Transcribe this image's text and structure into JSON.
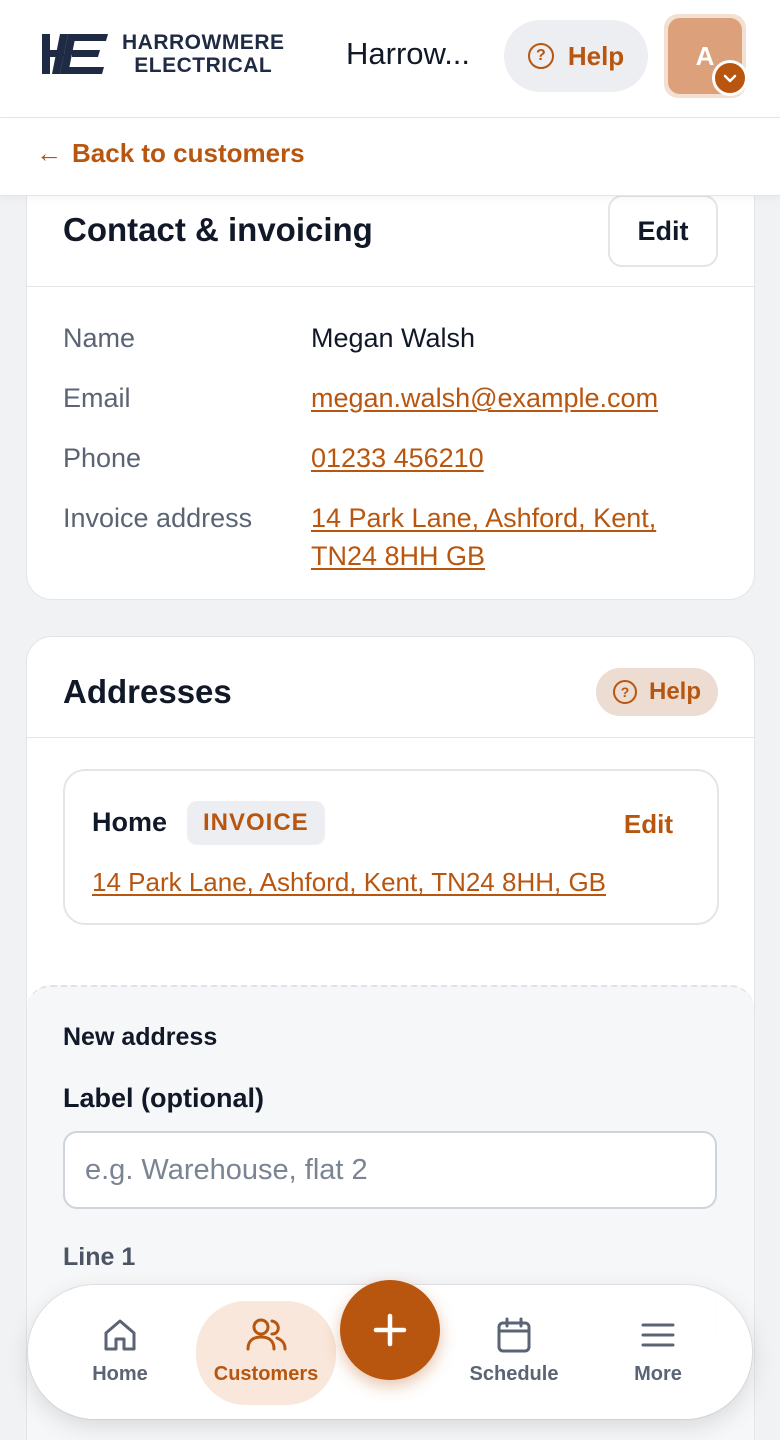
{
  "header": {
    "logo_line1": "HARROWMERE",
    "logo_line2": "ELECTRICAL",
    "app_title": "Harrow...",
    "help_label": "Help",
    "avatar_initial": "A"
  },
  "back": {
    "label": "Back to customers"
  },
  "contact": {
    "title": "Contact & invoicing",
    "edit_label": "Edit",
    "rows": [
      {
        "label": "Name",
        "value": "Megan Walsh"
      },
      {
        "label": "Email",
        "value": "megan.walsh@example.com"
      },
      {
        "label": "Phone",
        "value": "01233 456210"
      },
      {
        "label": "Invoice address",
        "value": "14 Park Lane, Ashford, Kent, TN24 8HH GB"
      }
    ]
  },
  "addresses": {
    "title": "Addresses",
    "help_label": "Help",
    "items": [
      {
        "label": "Home",
        "badge": "INVOICE",
        "edit_label": "Edit",
        "line": "14 Park Lane, Ashford, Kent, TN24 8HH, GB"
      }
    ],
    "new_address": {
      "title": "New address",
      "label_field": "Label (optional)",
      "label_placeholder": "e.g. Warehouse, flat 2",
      "line1_field": "Line 1"
    }
  },
  "nav": {
    "items": [
      {
        "label": "Home",
        "icon": "home-icon"
      },
      {
        "label": "Customers",
        "icon": "users-icon",
        "active": true
      },
      {
        "label": "Schedule",
        "icon": "calendar-icon"
      },
      {
        "label": "More",
        "icon": "menu-icon"
      }
    ],
    "fab_icon": "plus-icon"
  },
  "colors": {
    "accent": "#b8560f",
    "accent_soft": "#f5e1d3",
    "text": "#111827",
    "muted": "#5b6474"
  }
}
